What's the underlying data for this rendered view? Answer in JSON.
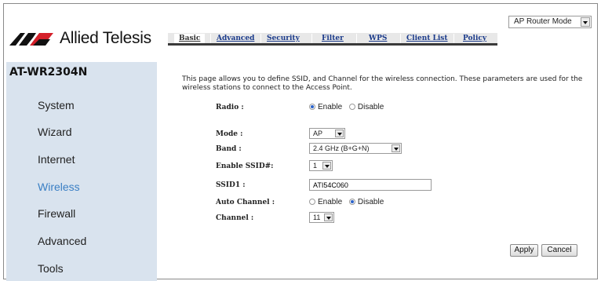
{
  "header": {
    "mode_select": {
      "value": "AP Router Mode"
    },
    "brand": "Allied Telesis",
    "tabs": [
      {
        "label": "Basic"
      },
      {
        "label": "Advanced"
      },
      {
        "label": "Security"
      },
      {
        "label": "Filter"
      },
      {
        "label": "WPS"
      },
      {
        "label": "Client List"
      },
      {
        "label": "Policy"
      }
    ],
    "active_tab": "Basic"
  },
  "sidebar": {
    "model": "AT-WR2304N",
    "items": [
      {
        "label": "System"
      },
      {
        "label": "Wizard"
      },
      {
        "label": "Internet"
      },
      {
        "label": "Wireless"
      },
      {
        "label": "Firewall"
      },
      {
        "label": "Advanced"
      },
      {
        "label": "Tools"
      }
    ],
    "active_item": "Wireless"
  },
  "main": {
    "description": "This page allows you to define SSID, and Channel for the wireless connection. These parameters are used for the wireless stations to connect to the Access Point.",
    "radio": {
      "label": "Radio :",
      "options": [
        "Enable",
        "Disable"
      ],
      "selected": "Enable"
    },
    "mode": {
      "label": "Mode :",
      "value": "AP"
    },
    "band": {
      "label": "Band :",
      "value": "2.4 GHz (B+G+N)"
    },
    "enable_ssid": {
      "label": "Enable SSID#:",
      "value": "1"
    },
    "ssid1": {
      "label": "SSID1 :",
      "value": "ATI54C060"
    },
    "auto_channel": {
      "label": "Auto Channel :",
      "options": [
        "Enable",
        "Disable"
      ],
      "selected": "Disable"
    },
    "channel": {
      "label": "Channel :",
      "value": "11"
    },
    "buttons": {
      "apply": "Apply",
      "cancel": "Cancel"
    }
  },
  "colors": {
    "sidebar_bg": "#d9e3ee",
    "active_nav": "#3a7fc4",
    "tab_link": "#1a3a8a",
    "radio_selected": "#2a62c9"
  }
}
